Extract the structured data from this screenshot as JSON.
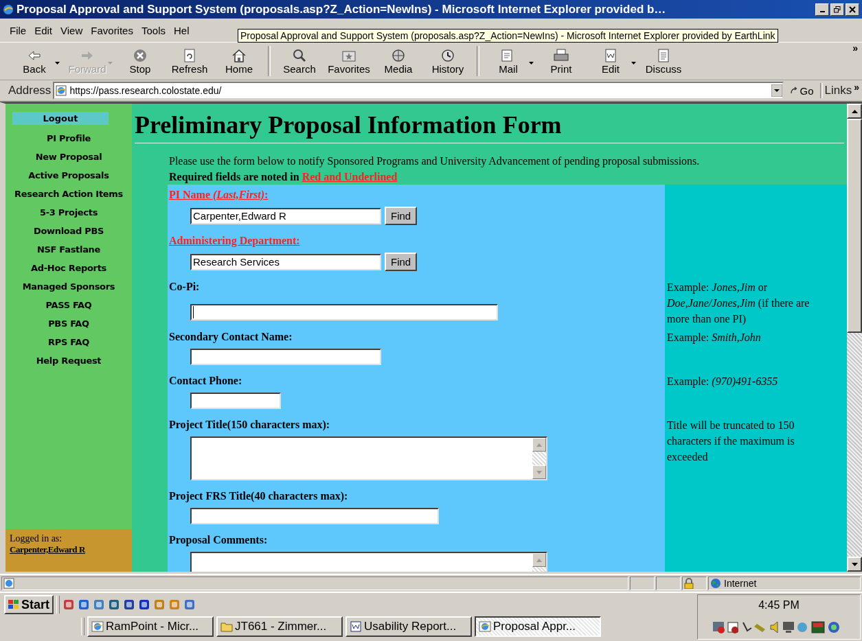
{
  "window": {
    "title": "Proposal Approval and Support System (proposals.asp?Z_Action=NewIns) - Microsoft Internet Explorer provided b…",
    "tooltip": "Proposal Approval and Support System (proposals.asp?Z_Action=NewIns) - Microsoft Internet Explorer provided by EarthLink"
  },
  "menu": [
    "File",
    "Edit",
    "View",
    "Favorites",
    "Tools",
    "Hel"
  ],
  "toolbar": [
    [
      {
        "kind": "back",
        "label": "Back",
        "disabled": false,
        "dropdown": true
      },
      {
        "kind": "forward",
        "label": "Forward",
        "disabled": true,
        "dropdown": true
      },
      {
        "kind": "stop",
        "label": "Stop",
        "disabled": false,
        "dropdown": false
      },
      {
        "kind": "refresh",
        "label": "Refresh",
        "disabled": false,
        "dropdown": false
      },
      {
        "kind": "home",
        "label": "Home",
        "disabled": false,
        "dropdown": false
      }
    ],
    [
      {
        "kind": "search",
        "label": "Search",
        "disabled": false,
        "dropdown": false
      },
      {
        "kind": "favorites",
        "label": "Favorites",
        "disabled": false,
        "dropdown": false
      },
      {
        "kind": "media",
        "label": "Media",
        "disabled": false,
        "dropdown": false
      },
      {
        "kind": "history",
        "label": "History",
        "disabled": false,
        "dropdown": false
      }
    ],
    [
      {
        "kind": "mail",
        "label": "Mail",
        "disabled": false,
        "dropdown": true
      },
      {
        "kind": "print",
        "label": "Print",
        "disabled": false,
        "dropdown": false
      },
      {
        "kind": "edit",
        "label": "Edit",
        "disabled": false,
        "dropdown": true
      },
      {
        "kind": "discuss",
        "label": "Discuss",
        "disabled": false,
        "dropdown": false
      }
    ]
  ],
  "toolbar_more": "»",
  "address": {
    "label": "Address",
    "url": "https://pass.research.colostate.edu/",
    "go": "Go",
    "links": "Links",
    "links_more": "»"
  },
  "sidebar": {
    "logout": "Logout",
    "items": [
      "PI Profile",
      "New Proposal",
      "Active Proposals",
      "Research Action Items",
      "5-3 Projects",
      "Download PBS",
      "NSF Fastlane",
      "Ad-Hoc Reports",
      "Managed Sponsors",
      "PASS FAQ",
      "PBS FAQ",
      "RPS FAQ",
      "Help Request"
    ],
    "logged_in_label": "Logged in as:",
    "user": "Carpenter,Edward R"
  },
  "page": {
    "heading": "Preliminary Proposal Information Form",
    "intro": "Please use the form below to notify Sponsored Programs and University Advancement of pending proposal submissions.",
    "required_note": "Required fields are noted in",
    "required_highlight": "Red and Underlined"
  },
  "fields": [
    {
      "kind": "text",
      "label": "PI Name *(Last,First)*:",
      "required": true,
      "value": "Carpenter,Edward R",
      "button": "Find",
      "focused": false
    },
    {
      "kind": "text",
      "label": "Administering Department:",
      "required": true,
      "value": "Research Services",
      "button": "Find",
      "focused": false
    },
    {
      "kind": "text",
      "label": "Co-Pi:",
      "required": false,
      "focused": true,
      "hint": "Example: *Jones,Jim* or *Doe,Jane/Jones,Jim* (if there are more than one PI)"
    },
    {
      "kind": "text",
      "label": "Secondary Contact Name:",
      "required": false,
      "focused": false,
      "hint": "Example: *Smith,John*"
    },
    {
      "kind": "text",
      "label": "Contact Phone:",
      "required": false,
      "focused": false,
      "hint": "Example: *(970)491-6355*"
    },
    {
      "kind": "textarea",
      "label": "Project Title(150 characters max):",
      "required": false,
      "focused": false,
      "hint": "Title will be truncated to 150 characters if the maximum is exceeded"
    },
    {
      "kind": "text",
      "label": "Project FRS Title(40 characters max):",
      "required": false,
      "focused": false
    },
    {
      "kind": "textarea",
      "label": "Proposal Comments:",
      "required": false,
      "focused": false
    }
  ],
  "status": {
    "zone": "Internet"
  },
  "taskbar": {
    "start": "Start",
    "tasks": [
      {
        "label": "RamPoint - Micr...",
        "kind": "browser",
        "selected": false
      },
      {
        "label": "JT661 - Zimmer...",
        "kind": "folder",
        "selected": false
      },
      {
        "label": "Usability Report...",
        "kind": "word",
        "selected": false
      },
      {
        "label": "Proposal Appr...",
        "kind": "browser",
        "selected": true
      }
    ],
    "clock": "4:45 PM"
  }
}
